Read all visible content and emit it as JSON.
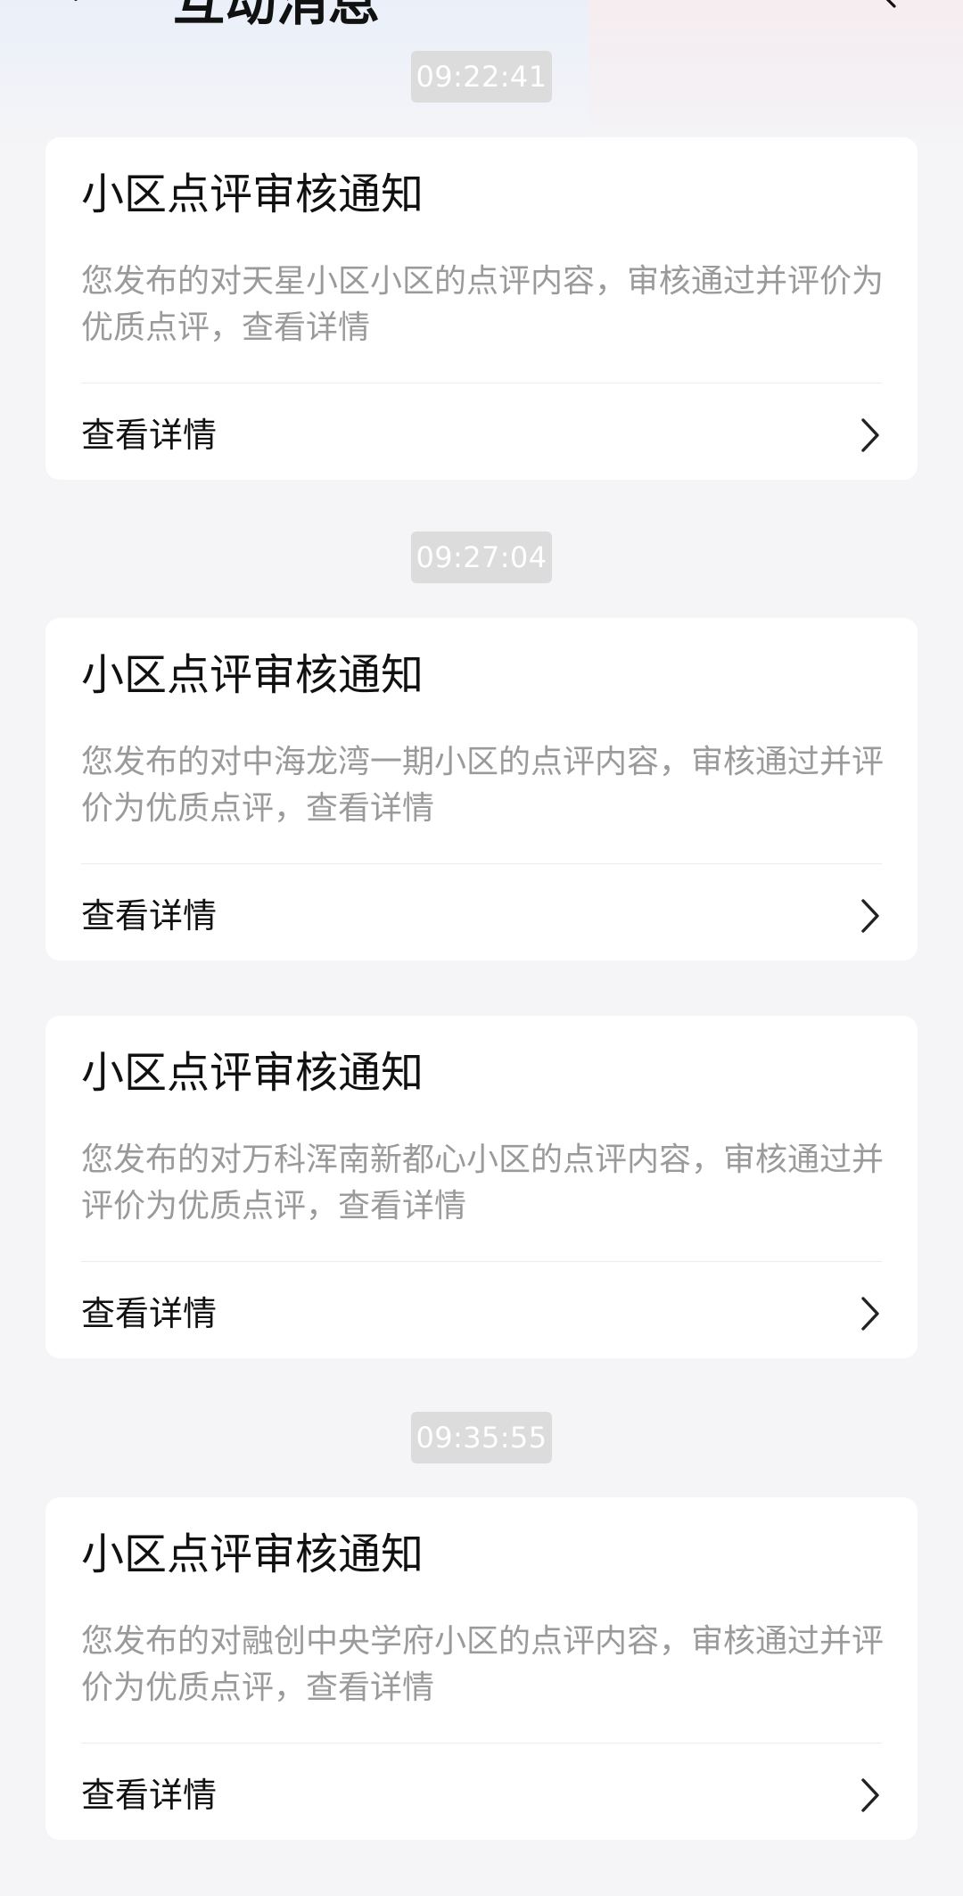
{
  "header": {
    "title": "互动消息"
  },
  "notifications": [
    {
      "time": "09:22:41",
      "title": "小区点评审核通知",
      "description": "您发布的对天星小区小区的点评内容，审核通过并评价为优质点评，查看详情",
      "action": "查看详情"
    },
    {
      "time": "09:27:04",
      "title": "小区点评审核通知",
      "description": "您发布的对中海龙湾一期小区的点评内容，审核通过并评价为优质点评，查看详情",
      "action": "查看详情"
    },
    {
      "title": "小区点评审核通知",
      "description": "您发布的对万科浑南新都心小区的点评内容，审核通过并评价为优质点评，查看详情",
      "action": "查看详情"
    },
    {
      "time": "09:35:55",
      "title": "小区点评审核通知",
      "description": "您发布的对融创中央学府小区的点评内容，审核通过并评价为优质点评，查看详情",
      "action": "查看详情"
    }
  ],
  "icons": {
    "back": "back-icon",
    "more": "more-icon",
    "chevron": "chevron-right-icon"
  }
}
